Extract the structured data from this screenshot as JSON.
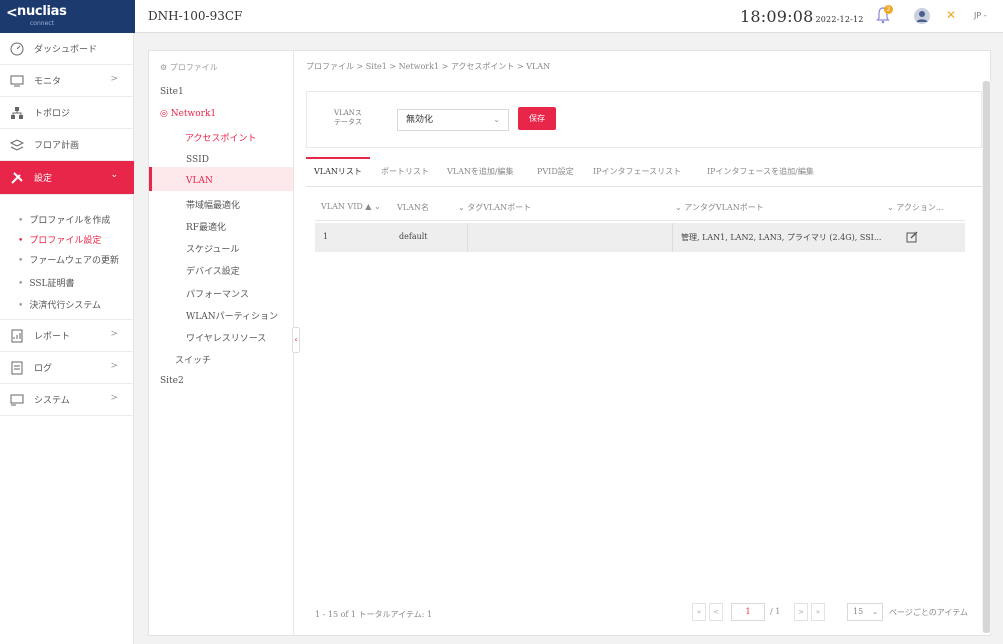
{
  "header": {
    "logo_chevron": "<",
    "logo_brand": "nuclias",
    "logo_sub": "connect",
    "device_name": "DNH-100-93CF",
    "time": "18:09:08",
    "date": "2022-12-12",
    "notification_count": "2",
    "language": "JP -"
  },
  "nav": {
    "items": [
      {
        "label": "ダッシュボード",
        "icon": "dashboard-icon"
      },
      {
        "label": "モニタ",
        "icon": "monitor-icon",
        "chevron": ">"
      },
      {
        "label": "トポロジ",
        "icon": "topology-icon"
      },
      {
        "label": "フロア計画",
        "icon": "floorplan-icon"
      },
      {
        "label": "設定",
        "icon": "settings-icon",
        "chevron": "⌄"
      },
      {
        "label": "レポート",
        "icon": "report-icon",
        "chevron": ">"
      },
      {
        "label": "ログ",
        "icon": "log-icon",
        "chevron": ">"
      },
      {
        "label": "システム",
        "icon": "system-icon",
        "chevron": ">"
      }
    ],
    "sub_items": [
      "プロファイルを作成",
      "プロファイル設定",
      "ファームウェアの更新",
      "SSL証明書",
      "決済代行システム"
    ]
  },
  "tree": {
    "title": "プロファイル",
    "site1": "Site1",
    "network1": "Network1",
    "access_point": "アクセスポイント",
    "children": [
      "SSID",
      "VLAN",
      "帯域幅最適化",
      "RF最適化",
      "スケジュール",
      "デバイス設定",
      "パフォーマンス",
      "WLANパーティション",
      "ワイヤレスリソース"
    ],
    "switch": "スイッチ",
    "site2": "Site2"
  },
  "breadcrumb": "プロファイル > Site1 > Network1 > アクセスポイント > VLAN",
  "vlan_status": {
    "label": "VLANステータス",
    "value": "無効化",
    "save": "保存"
  },
  "tabs": [
    "VLANリスト",
    "ポートリスト",
    "VLANを追加/編集",
    "PVID設定",
    "IPインタフェースリスト",
    "IPインタフェースを追加/編集"
  ],
  "table": {
    "headers": [
      "VLAN VID ▲ ⌄",
      "VLAN名",
      "⌄ タグVLANポート",
      "⌄ アンタグVLANポート",
      "⌄ アクション..."
    ],
    "rows": [
      {
        "vid": "1",
        "name": "default",
        "tagged": "",
        "untagged": "管理, LAN1, LAN2, LAN3, プライマリ (2.4G), SSI..."
      }
    ]
  },
  "pager": {
    "info": "1 - 15 of 1 トータルアイテム: 1",
    "first": "«",
    "prev": "<",
    "current": "1",
    "total": "/ 1",
    "next": ">",
    "last": "»",
    "page_size": "15",
    "page_size_label": "ページごとのアイテム"
  },
  "colors": {
    "accent": "#e8264a",
    "logo_bg": "#1c3a6e"
  }
}
